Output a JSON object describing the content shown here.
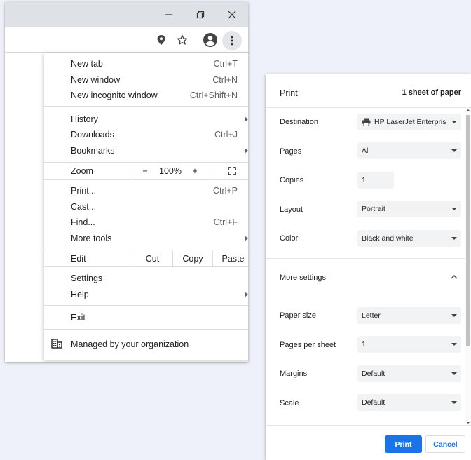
{
  "window": {
    "minimize_icon": "minimize-icon",
    "restore_icon": "restore-icon",
    "close_icon": "close-icon"
  },
  "toolbar": {
    "icons": [
      "location-pin-icon",
      "star-icon",
      "profile-icon",
      "more-vert-icon"
    ]
  },
  "menu": {
    "new_tab": {
      "label": "New tab",
      "shortcut": "Ctrl+T"
    },
    "new_window": {
      "label": "New window",
      "shortcut": "Ctrl+N"
    },
    "new_incognito": {
      "label": "New incognito window",
      "shortcut": "Ctrl+Shift+N"
    },
    "history": {
      "label": "History"
    },
    "downloads": {
      "label": "Downloads",
      "shortcut": "Ctrl+J"
    },
    "bookmarks": {
      "label": "Bookmarks"
    },
    "zoom": {
      "label": "Zoom",
      "minus": "−",
      "level": "100%",
      "plus": "+"
    },
    "print": {
      "label": "Print...",
      "shortcut": "Ctrl+P"
    },
    "cast": {
      "label": "Cast..."
    },
    "find": {
      "label": "Find...",
      "shortcut": "Ctrl+F"
    },
    "more_tools": {
      "label": "More tools"
    },
    "edit": {
      "label": "Edit",
      "cut": "Cut",
      "copy": "Copy",
      "paste": "Paste"
    },
    "settings": {
      "label": "Settings"
    },
    "help": {
      "label": "Help"
    },
    "exit": {
      "label": "Exit"
    },
    "managed": {
      "label": "Managed by your organization"
    }
  },
  "print_dialog": {
    "title": "Print",
    "sheets": "1 sheet of paper",
    "destination": {
      "label": "Destination",
      "value": "HP LaserJet Enterprise"
    },
    "pages": {
      "label": "Pages",
      "value": "All"
    },
    "copies": {
      "label": "Copies",
      "value": "1"
    },
    "layout": {
      "label": "Layout",
      "value": "Portrait"
    },
    "color": {
      "label": "Color",
      "value": "Black and white"
    },
    "more_settings": {
      "label": "More settings"
    },
    "paper_size": {
      "label": "Paper size",
      "value": "Letter"
    },
    "pages_per_sheet": {
      "label": "Pages per sheet",
      "value": "1"
    },
    "margins": {
      "label": "Margins",
      "value": "Default"
    },
    "scale": {
      "label": "Scale",
      "value": "Default"
    },
    "print_button": "Print",
    "cancel_button": "Cancel",
    "accent_color": "#1a73e8"
  }
}
